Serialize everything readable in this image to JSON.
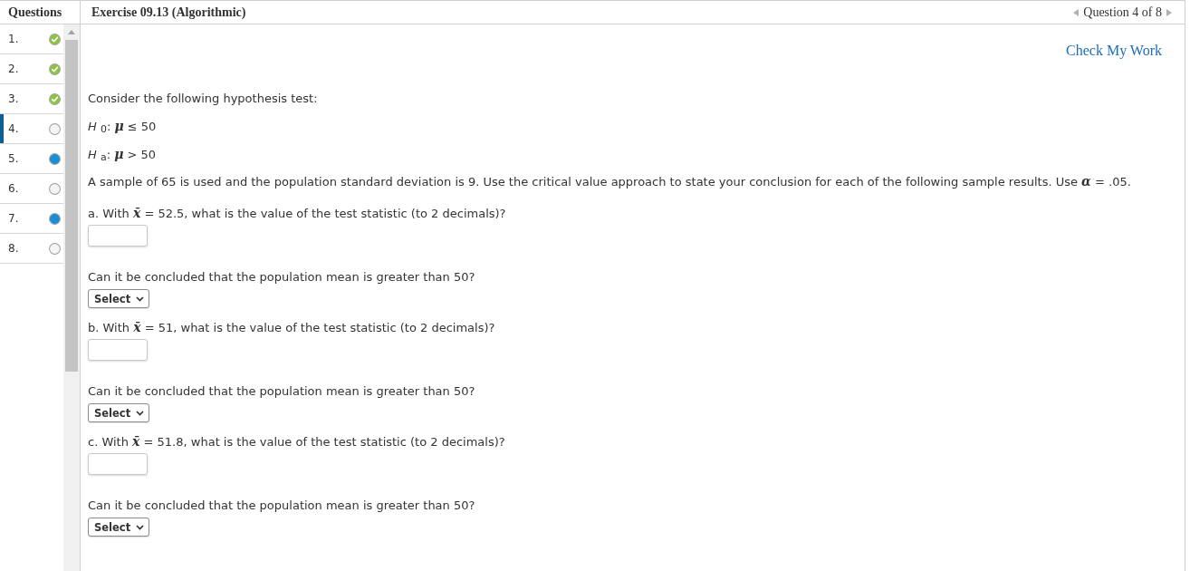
{
  "sidebar": {
    "title": "Questions",
    "questions": [
      {
        "number": "1.",
        "kind": "correct",
        "selected": false
      },
      {
        "number": "2.",
        "kind": "correct",
        "selected": false
      },
      {
        "number": "3.",
        "kind": "correct",
        "selected": false
      },
      {
        "number": "4.",
        "kind": "unanswered",
        "selected": true
      },
      {
        "number": "5.",
        "kind": "answered",
        "selected": false
      },
      {
        "number": "6.",
        "kind": "unanswered",
        "selected": false
      },
      {
        "number": "7.",
        "kind": "answered",
        "selected": false
      },
      {
        "number": "8.",
        "kind": "unanswered",
        "selected": false
      }
    ]
  },
  "header": {
    "title": "Exercise 09.13 (Algorithmic)",
    "position": "Question 4 of 8"
  },
  "check_my_work": "Check My Work",
  "problem": {
    "intro": "Consider the following hypothesis test:",
    "hypotheses": [
      "*H* $_{0}$: **μ** ≤ 50",
      "*H* $_{a}$: **μ** > 50"
    ],
    "statement": "A sample of 65 is used and the population standard deviation is 9. Use the critical value approach to state your conclusion for each of the following sample results. Use **α** = .05.",
    "parts": [
      {
        "prompt": "a. With **x̄** = 52.5, what is the value of the test statistic (to 2 decimals)?",
        "conclusion": "Can it be concluded that the population mean is greater than 50?",
        "dropdown": "Select"
      },
      {
        "prompt": "b. With **x̄** = 51, what is the value of the test statistic (to 2 decimals)?",
        "conclusion": "Can it be concluded that the population mean is greater than 50?",
        "dropdown": "Select"
      },
      {
        "prompt": "c. With **x̄** = 51.8, what is the value of the test statistic (to 2 decimals)?",
        "conclusion": "Can it be concluded that the population mean is greater than 50?",
        "dropdown": "Select"
      }
    ]
  }
}
